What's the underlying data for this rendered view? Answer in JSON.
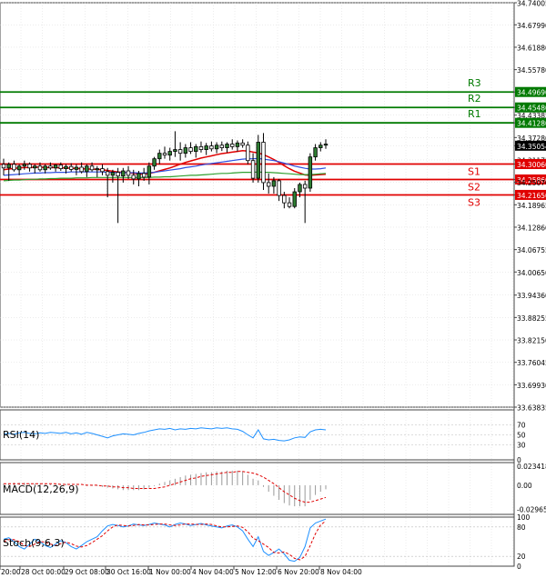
{
  "chart_data": {
    "type": "candlestick",
    "price_axis": {
      "ticks": [
        "34.74005",
        "34.67990",
        "34.61880",
        "34.55780",
        "34.49690",
        "34.45480",
        "34.43385",
        "34.41280",
        "34.37280",
        "34.35054",
        "34.31175",
        "34.30060",
        "34.25860",
        "34.25070",
        "34.21650",
        "34.18965",
        "34.12860",
        "34.06755",
        "34.00650",
        "33.94360",
        "33.88255",
        "33.82150",
        "33.76045",
        "33.69930",
        "33.63835"
      ],
      "range": [
        33.63835,
        34.74005
      ]
    },
    "x_ticks": [
      "20:00",
      "28 Oct 00:00",
      "29 Oct 08:00",
      "30 Oct 16:00",
      "1 Nov 00:00",
      "4 Nov 04:00",
      "5 Nov 12:00",
      "6 Nov 20:00",
      "8 Nov 04:00"
    ],
    "candles": [
      {
        "o": 34.3,
        "h": 34.315,
        "l": 34.27,
        "c": 34.29
      },
      {
        "o": 34.29,
        "h": 34.305,
        "l": 34.255,
        "c": 34.3
      },
      {
        "o": 34.3,
        "h": 34.31,
        "l": 34.28,
        "c": 34.285
      },
      {
        "o": 34.285,
        "h": 34.3,
        "l": 34.27,
        "c": 34.295
      },
      {
        "o": 34.295,
        "h": 34.31,
        "l": 34.285,
        "c": 34.3
      },
      {
        "o": 34.3,
        "h": 34.305,
        "l": 34.28,
        "c": 34.29
      },
      {
        "o": 34.29,
        "h": 34.3,
        "l": 34.275,
        "c": 34.295
      },
      {
        "o": 34.295,
        "h": 34.305,
        "l": 34.28,
        "c": 34.285
      },
      {
        "o": 34.285,
        "h": 34.3,
        "l": 34.275,
        "c": 34.295
      },
      {
        "o": 34.295,
        "h": 34.305,
        "l": 34.285,
        "c": 34.29
      },
      {
        "o": 34.29,
        "h": 34.3,
        "l": 34.28,
        "c": 34.298
      },
      {
        "o": 34.298,
        "h": 34.305,
        "l": 34.282,
        "c": 34.288
      },
      {
        "o": 34.288,
        "h": 34.3,
        "l": 34.275,
        "c": 34.294
      },
      {
        "o": 34.294,
        "h": 34.303,
        "l": 34.28,
        "c": 34.286
      },
      {
        "o": 34.286,
        "h": 34.3,
        "l": 34.27,
        "c": 34.292
      },
      {
        "o": 34.292,
        "h": 34.305,
        "l": 34.275,
        "c": 34.28
      },
      {
        "o": 34.28,
        "h": 34.3,
        "l": 34.265,
        "c": 34.295
      },
      {
        "o": 34.295,
        "h": 34.305,
        "l": 34.28,
        "c": 34.285
      },
      {
        "o": 34.285,
        "h": 34.295,
        "l": 34.265,
        "c": 34.288
      },
      {
        "o": 34.288,
        "h": 34.3,
        "l": 34.27,
        "c": 34.28
      },
      {
        "o": 34.28,
        "h": 34.29,
        "l": 34.21,
        "c": 34.27
      },
      {
        "o": 34.27,
        "h": 34.285,
        "l": 34.25,
        "c": 34.278
      },
      {
        "o": 34.278,
        "h": 34.29,
        "l": 34.14,
        "c": 34.268
      },
      {
        "o": 34.268,
        "h": 34.29,
        "l": 34.25,
        "c": 34.282
      },
      {
        "o": 34.282,
        "h": 34.295,
        "l": 34.26,
        "c": 34.27
      },
      {
        "o": 34.27,
        "h": 34.285,
        "l": 34.245,
        "c": 34.26
      },
      {
        "o": 34.26,
        "h": 34.282,
        "l": 34.24,
        "c": 34.275
      },
      {
        "o": 34.275,
        "h": 34.29,
        "l": 34.255,
        "c": 34.265
      },
      {
        "o": 34.265,
        "h": 34.305,
        "l": 34.245,
        "c": 34.295
      },
      {
        "o": 34.295,
        "h": 34.32,
        "l": 34.285,
        "c": 34.315
      },
      {
        "o": 34.315,
        "h": 34.34,
        "l": 34.3,
        "c": 34.33
      },
      {
        "o": 34.33,
        "h": 34.348,
        "l": 34.315,
        "c": 34.325
      },
      {
        "o": 34.325,
        "h": 34.345,
        "l": 34.31,
        "c": 34.335
      },
      {
        "o": 34.335,
        "h": 34.39,
        "l": 34.32,
        "c": 34.34
      },
      {
        "o": 34.34,
        "h": 34.36,
        "l": 34.31,
        "c": 34.33
      },
      {
        "o": 34.33,
        "h": 34.355,
        "l": 34.318,
        "c": 34.345
      },
      {
        "o": 34.345,
        "h": 34.36,
        "l": 34.328,
        "c": 34.335
      },
      {
        "o": 34.335,
        "h": 34.355,
        "l": 34.318,
        "c": 34.348
      },
      {
        "o": 34.348,
        "h": 34.362,
        "l": 34.332,
        "c": 34.34
      },
      {
        "o": 34.34,
        "h": 34.358,
        "l": 34.325,
        "c": 34.35
      },
      {
        "o": 34.35,
        "h": 34.362,
        "l": 34.335,
        "c": 34.342
      },
      {
        "o": 34.342,
        "h": 34.36,
        "l": 34.33,
        "c": 34.352
      },
      {
        "o": 34.352,
        "h": 34.362,
        "l": 34.336,
        "c": 34.345
      },
      {
        "o": 34.345,
        "h": 34.36,
        "l": 34.332,
        "c": 34.355
      },
      {
        "o": 34.355,
        "h": 34.368,
        "l": 34.34,
        "c": 34.348
      },
      {
        "o": 34.348,
        "h": 34.365,
        "l": 34.335,
        "c": 34.358
      },
      {
        "o": 34.358,
        "h": 34.368,
        "l": 34.345,
        "c": 34.352
      },
      {
        "o": 34.352,
        "h": 34.362,
        "l": 34.3,
        "c": 34.31
      },
      {
        "o": 34.31,
        "h": 34.33,
        "l": 34.25,
        "c": 34.262
      },
      {
        "o": 34.262,
        "h": 34.38,
        "l": 34.25,
        "c": 34.36
      },
      {
        "o": 34.36,
        "h": 34.385,
        "l": 34.23,
        "c": 34.25
      },
      {
        "o": 34.25,
        "h": 34.275,
        "l": 34.22,
        "c": 34.24
      },
      {
        "o": 34.24,
        "h": 34.265,
        "l": 34.22,
        "c": 34.255
      },
      {
        "o": 34.255,
        "h": 34.26,
        "l": 34.2,
        "c": 34.215
      },
      {
        "o": 34.215,
        "h": 34.225,
        "l": 34.18,
        "c": 34.195
      },
      {
        "o": 34.195,
        "h": 34.21,
        "l": 34.18,
        "c": 34.185
      },
      {
        "o": 34.185,
        "h": 34.235,
        "l": 34.18,
        "c": 34.225
      },
      {
        "o": 34.225,
        "h": 34.25,
        "l": 34.21,
        "c": 34.245
      },
      {
        "o": 34.245,
        "h": 34.255,
        "l": 34.14,
        "c": 34.235
      },
      {
        "o": 34.235,
        "h": 34.33,
        "l": 34.225,
        "c": 34.32
      },
      {
        "o": 34.32,
        "h": 34.355,
        "l": 34.31,
        "c": 34.345
      },
      {
        "o": 34.345,
        "h": 34.36,
        "l": 34.335,
        "c": 34.352
      },
      {
        "o": 34.352,
        "h": 34.368,
        "l": 34.342,
        "c": 34.355
      }
    ],
    "moving_averages": [
      {
        "color": "#e00000",
        "values": [
          34.285,
          34.287,
          34.289,
          34.29,
          34.291,
          34.291,
          34.292,
          34.292,
          34.291,
          34.291,
          34.291,
          34.29,
          34.29,
          34.289,
          34.289,
          34.288,
          34.287,
          34.287,
          34.286,
          34.285,
          34.283,
          34.281,
          34.279,
          34.278,
          34.277,
          34.275,
          34.274,
          34.273,
          34.275,
          34.278,
          34.282,
          34.286,
          34.29,
          34.295,
          34.3,
          34.305,
          34.309,
          34.313,
          34.317,
          34.32,
          34.323,
          34.326,
          34.329,
          34.331,
          34.333,
          34.335,
          34.337,
          34.336,
          34.333,
          34.331,
          34.326,
          34.32,
          34.313,
          34.305,
          34.296,
          34.288,
          34.281,
          34.276,
          34.271,
          34.27,
          34.271,
          34.272,
          34.273
        ]
      },
      {
        "color": "#3050e0",
        "values": [
          34.27,
          34.271,
          34.272,
          34.273,
          34.274,
          34.275,
          34.276,
          34.276,
          34.277,
          34.277,
          34.278,
          34.278,
          34.278,
          34.279,
          34.279,
          34.279,
          34.279,
          34.279,
          34.279,
          34.279,
          34.278,
          34.278,
          34.277,
          34.277,
          34.277,
          34.277,
          34.276,
          34.276,
          34.277,
          34.278,
          34.28,
          34.282,
          34.284,
          34.286,
          34.288,
          34.291,
          34.293,
          34.295,
          34.298,
          34.3,
          34.302,
          34.304,
          34.306,
          34.308,
          34.31,
          34.312,
          34.314,
          34.315,
          34.315,
          34.316,
          34.314,
          34.312,
          34.31,
          34.307,
          34.303,
          34.299,
          34.295,
          34.292,
          34.289,
          34.287,
          34.287,
          34.288,
          34.29
        ]
      },
      {
        "color": "#30a030",
        "values": [
          34.255,
          34.256,
          34.257,
          34.257,
          34.258,
          34.259,
          34.259,
          34.26,
          34.26,
          34.261,
          34.261,
          34.262,
          34.262,
          34.262,
          34.263,
          34.263,
          34.263,
          34.264,
          34.264,
          34.264,
          34.264,
          34.264,
          34.264,
          34.264,
          34.264,
          34.264,
          34.264,
          34.264,
          34.264,
          34.265,
          34.265,
          34.266,
          34.266,
          34.267,
          34.268,
          34.269,
          34.27,
          34.27,
          34.271,
          34.272,
          34.273,
          34.274,
          34.275,
          34.275,
          34.276,
          34.277,
          34.278,
          34.278,
          34.278,
          34.279,
          34.278,
          34.278,
          34.277,
          34.276,
          34.275,
          34.274,
          34.273,
          34.272,
          34.272,
          34.272,
          34.273,
          34.274,
          34.275
        ]
      }
    ],
    "levels": [
      {
        "label": "R3",
        "value": 34.4969,
        "color": "#007a00"
      },
      {
        "label": "R2",
        "value": 34.4548,
        "color": "#007a00"
      },
      {
        "label": "R1",
        "value": 34.4128,
        "color": "#007a00"
      },
      {
        "label": "S1",
        "value": 34.3006,
        "color": "#e00000"
      },
      {
        "label": "S2",
        "value": 34.2586,
        "color": "#e00000"
      },
      {
        "label": "S3",
        "value": 34.2165,
        "color": "#e00000"
      }
    ],
    "current_price": "34.35054",
    "rsi": {
      "title": "RSI(14)",
      "ticks": [
        "70",
        "50",
        "30",
        "0"
      ],
      "range": [
        0,
        100
      ],
      "values": [
        52,
        53,
        51,
        54,
        55,
        53,
        52,
        54,
        53,
        55,
        54,
        53,
        55,
        52,
        54,
        51,
        55,
        53,
        50,
        47,
        44,
        48,
        50,
        52,
        51,
        50,
        53,
        55,
        58,
        60,
        62,
        61,
        63,
        60,
        62,
        61,
        63,
        62,
        64,
        63,
        62,
        64,
        63,
        64,
        62,
        61,
        57,
        50,
        44,
        60,
        42,
        40,
        41,
        39,
        38,
        40,
        44,
        46,
        45,
        56,
        60,
        61,
        60
      ]
    },
    "macd": {
      "title": "MACD(12,26,9)",
      "ticks": [
        "0.023418",
        "0.00",
        "-0.029658"
      ],
      "range": [
        -0.036,
        0.028
      ],
      "histogram": [
        0.002,
        0.002,
        0.003,
        0.003,
        0.003,
        0.002,
        0.002,
        0.002,
        0.001,
        0.001,
        0.001,
        0.001,
        0.001,
        0.0,
        0.0,
        0.0,
        -0.001,
        -0.001,
        -0.001,
        -0.002,
        -0.003,
        -0.004,
        -0.005,
        -0.006,
        -0.006,
        -0.006,
        -0.006,
        -0.005,
        -0.003,
        -0.001,
        0.002,
        0.004,
        0.006,
        0.008,
        0.01,
        0.012,
        0.013,
        0.014,
        0.015,
        0.016,
        0.016,
        0.017,
        0.017,
        0.018,
        0.018,
        0.018,
        0.017,
        0.013,
        0.008,
        0.006,
        -0.002,
        -0.008,
        -0.013,
        -0.018,
        -0.022,
        -0.025,
        -0.026,
        -0.026,
        -0.026,
        -0.018,
        -0.012,
        -0.008,
        -0.005
      ],
      "signal": [
        0.002,
        0.002,
        0.002,
        0.002,
        0.002,
        0.002,
        0.002,
        0.002,
        0.002,
        0.002,
        0.002,
        0.001,
        0.001,
        0.001,
        0.001,
        0.001,
        0.0,
        0.0,
        0.0,
        -0.001,
        -0.001,
        -0.002,
        -0.002,
        -0.003,
        -0.003,
        -0.004,
        -0.004,
        -0.004,
        -0.004,
        -0.004,
        -0.003,
        -0.002,
        0.0,
        0.002,
        0.004,
        0.006,
        0.008,
        0.009,
        0.011,
        0.012,
        0.013,
        0.014,
        0.015,
        0.016,
        0.016,
        0.017,
        0.017,
        0.016,
        0.015,
        0.013,
        0.01,
        0.006,
        0.002,
        -0.003,
        -0.008,
        -0.012,
        -0.016,
        -0.019,
        -0.021,
        -0.021,
        -0.019,
        -0.017,
        -0.015
      ]
    },
    "stoch": {
      "title": "Stoch(9,6,3)",
      "ticks": [
        "100",
        "80",
        "20",
        "0"
      ],
      "range": [
        0,
        100
      ],
      "main": [
        55,
        58,
        50,
        40,
        35,
        45,
        55,
        50,
        42,
        38,
        45,
        52,
        48,
        40,
        35,
        42,
        50,
        55,
        60,
        72,
        82,
        85,
        83,
        80,
        82,
        86,
        84,
        83,
        85,
        88,
        86,
        84,
        80,
        85,
        88,
        86,
        83,
        85,
        87,
        84,
        82,
        80,
        78,
        82,
        84,
        80,
        72,
        55,
        40,
        60,
        30,
        22,
        28,
        35,
        25,
        12,
        10,
        18,
        40,
        78,
        88,
        92,
        96
      ],
      "signal": [
        50,
        54,
        54,
        50,
        42,
        40,
        45,
        50,
        49,
        45,
        42,
        46,
        49,
        46,
        41,
        39,
        42,
        48,
        55,
        62,
        72,
        80,
        84,
        83,
        82,
        83,
        85,
        84,
        84,
        85,
        86,
        86,
        84,
        83,
        84,
        86,
        86,
        85,
        85,
        86,
        85,
        82,
        80,
        80,
        81,
        82,
        79,
        70,
        57,
        52,
        45,
        38,
        28,
        27,
        29,
        24,
        16,
        13,
        20,
        42,
        66,
        84,
        92
      ]
    }
  }
}
